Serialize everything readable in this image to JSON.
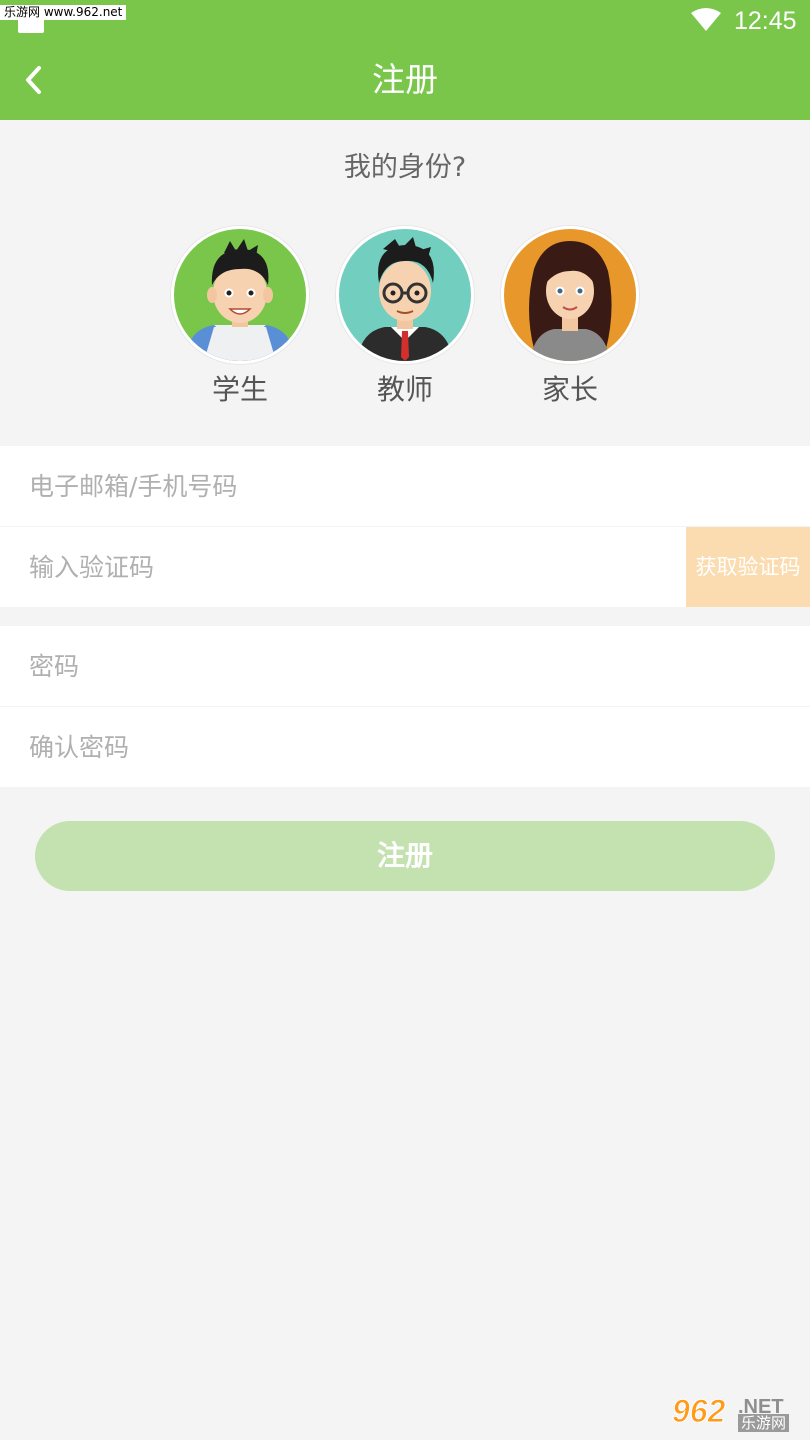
{
  "status_bar": {
    "watermark": "乐游网 www.962.net",
    "time": "12:45",
    "icons": [
      "wifi-icon"
    ]
  },
  "header": {
    "title": "注册",
    "back_icon": "chevron-left-icon"
  },
  "identity": {
    "question": "我的身份?",
    "roles": [
      {
        "label": "学生",
        "avatar_color": "#79c64b"
      },
      {
        "label": "教师",
        "avatar_color": "#72cfbf"
      },
      {
        "label": "家长",
        "avatar_color": "#e8982a"
      }
    ]
  },
  "form": {
    "email_placeholder": "电子邮箱/手机号码",
    "code_placeholder": "输入验证码",
    "get_code_label": "获取验证码",
    "password_placeholder": "密码",
    "confirm_placeholder": "确认密码",
    "submit_label": "注册"
  },
  "watermark_logo": {
    "digits": "962",
    "net": ".NET",
    "cn": "乐游网"
  },
  "colors": {
    "primary": "#79c64b",
    "submit_disabled": "#c4e2b0",
    "code_button": "#fbdcb1",
    "background": "#f4f4f4"
  }
}
